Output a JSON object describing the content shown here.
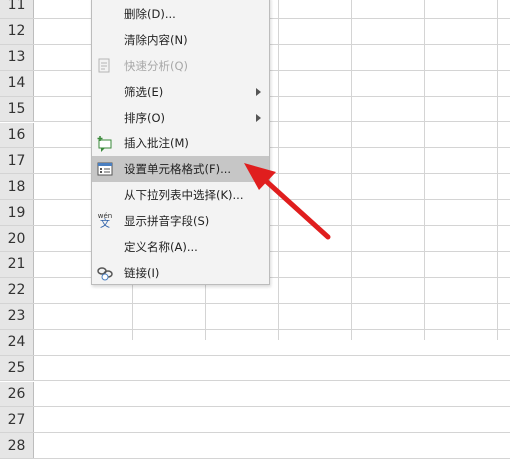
{
  "rows": [
    "11",
    "12",
    "13",
    "14",
    "15",
    "16",
    "17",
    "18",
    "19",
    "20",
    "21",
    "22",
    "23",
    "24",
    "25",
    "26",
    "27",
    "28"
  ],
  "menu": {
    "items": [
      {
        "label": "删除(D)...",
        "disabled": false,
        "submenu": false,
        "highlight": false,
        "icon": ""
      },
      {
        "label": "清除内容(N)",
        "disabled": false,
        "submenu": false,
        "highlight": false,
        "icon": ""
      },
      {
        "label": "快速分析(Q)",
        "disabled": true,
        "submenu": false,
        "highlight": false,
        "icon": "quick-analysis-icon"
      },
      {
        "label": "筛选(E)",
        "disabled": false,
        "submenu": true,
        "highlight": false,
        "icon": ""
      },
      {
        "label": "排序(O)",
        "disabled": false,
        "submenu": true,
        "highlight": false,
        "icon": ""
      },
      {
        "label": "插入批注(M)",
        "disabled": false,
        "submenu": false,
        "highlight": false,
        "icon": "insert-comment-icon"
      },
      {
        "label": "设置单元格格式(F)...",
        "disabled": false,
        "submenu": false,
        "highlight": true,
        "icon": "format-cells-icon"
      },
      {
        "label": "从下拉列表中选择(K)...",
        "disabled": false,
        "submenu": false,
        "highlight": false,
        "icon": ""
      },
      {
        "label": "显示拼音字段(S)",
        "disabled": false,
        "submenu": false,
        "highlight": false,
        "icon": "phonetic-icon"
      },
      {
        "label": "定义名称(A)...",
        "disabled": false,
        "submenu": false,
        "highlight": false,
        "icon": ""
      },
      {
        "label": "链接(I)",
        "disabled": false,
        "submenu": false,
        "highlight": false,
        "icon": "link-icon"
      }
    ]
  },
  "phonetic_icon": {
    "top": "wén",
    "bottom": "文"
  },
  "colors": {
    "annotation_arrow": "#e01e1e",
    "highlight": "#c6c6c6",
    "menu_bg": "#f3f3f3"
  }
}
